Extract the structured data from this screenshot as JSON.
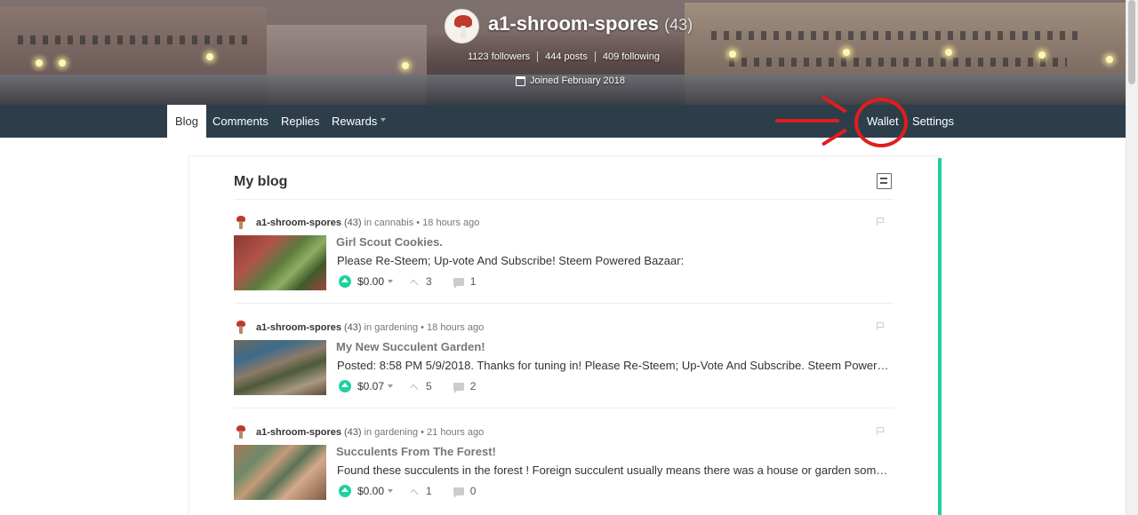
{
  "profile": {
    "name": "a1-shroom-spores",
    "reputation": "(43)",
    "followers": "1123 followers",
    "posts": "444 posts",
    "following": "409 following",
    "joined": "Joined February 2018"
  },
  "nav": {
    "blog": "Blog",
    "comments": "Comments",
    "replies": "Replies",
    "rewards": "Rewards",
    "wallet": "Wallet",
    "settings": "Settings"
  },
  "blog": {
    "title": "My blog",
    "posts": [
      {
        "author": "a1-shroom-spores",
        "rep": "(43)",
        "meta": "in cannabis • 18 hours ago",
        "title": "Girl Scout Cookies.",
        "body": "Please Re-Steem; Up-vote And Subscribe! Steem Powered Bazaar:",
        "payout": "$0.00",
        "votes": "3",
        "comments": "1"
      },
      {
        "author": "a1-shroom-spores",
        "rep": "(43)",
        "meta": "in gardening • 18 hours ago",
        "title": "My New Succulent Garden!",
        "body": "Posted: 8:58 PM 5/9/2018. Thanks for tuning in! Please Re-Steem; Up-Vote And Subscribe. Steem Powered Bazaar:",
        "payout": "$0.07",
        "votes": "5",
        "comments": "2"
      },
      {
        "author": "a1-shroom-spores",
        "rep": "(43)",
        "meta": "in gardening • 21 hours ago",
        "title": "Succulents From The Forest!",
        "body": "Found these succulents in the forest ! Foreign succulent usually means there was a house or garden some time ago",
        "payout": "$0.00",
        "votes": "1",
        "comments": "0"
      }
    ]
  },
  "colors": {
    "navbar": "#2c3e4a",
    "accent": "#1fd1a1",
    "annotation": "#e11d1d"
  }
}
